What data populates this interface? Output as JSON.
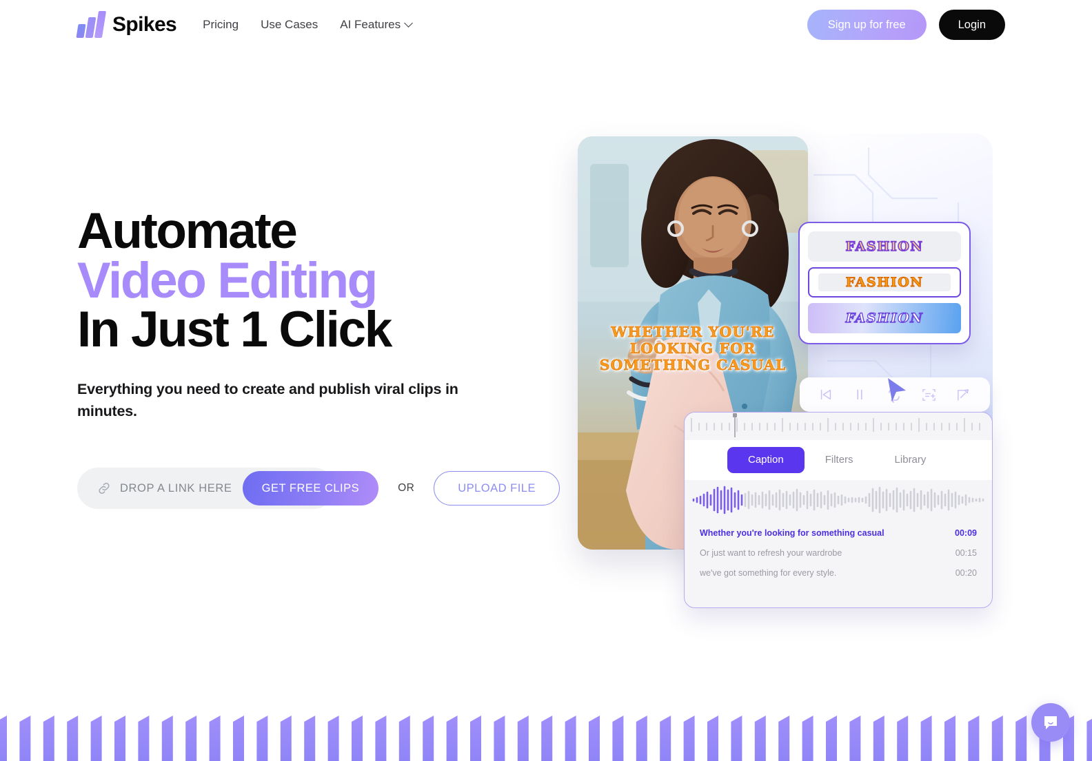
{
  "header": {
    "brand_name": "Spikes",
    "logo_icon": "spikes-bars-logo",
    "nav": [
      {
        "label": "Pricing",
        "icon": ""
      },
      {
        "label": "Use Cases",
        "icon": ""
      },
      {
        "label": "AI Features",
        "icon": "chevron-down-icon"
      }
    ],
    "signup_label": "Sign up for free",
    "login_label": "Login"
  },
  "hero": {
    "title_line1": "Automate",
    "title_line2": "Video Editing",
    "title_line3": "In Just 1 Click",
    "accent_color": "#a78bfa",
    "subtitle": "Everything you need to create and publish viral clips in minutes.",
    "cta": {
      "link_icon": "link-chain-icon",
      "link_placeholder": "DROP A LINK HERE",
      "link_value": "",
      "primary_label": "GET FREE CLIPS",
      "or_label": "OR",
      "upload_label": "UPLOAD FILE"
    }
  },
  "mockup": {
    "video_caption": "WHETHER YOU'RE LOOKING FOR SOMETHING CASUAL",
    "caption_styles": [
      {
        "label": "FASHION",
        "selected": false
      },
      {
        "label": "FASHION",
        "selected": true
      },
      {
        "label": "FASHION",
        "selected": false
      }
    ],
    "player_controls": [
      "skip-back-icon",
      "pause-icon",
      "loop-icon",
      "add-caption-icon",
      "expand-icon"
    ],
    "tabs": [
      {
        "label": "Caption",
        "active": true
      },
      {
        "label": "Filters",
        "active": false
      },
      {
        "label": "Library",
        "active": false
      }
    ],
    "transcript": [
      {
        "text": "Whether you're looking for something casual",
        "time": "00:09",
        "active": true
      },
      {
        "text": "Or just want to refresh your wardrobe",
        "time": "00:15",
        "active": false
      },
      {
        "text": "we've got something for every style.",
        "time": "00:20",
        "active": false
      }
    ]
  },
  "chat": {
    "icon": "chat-bubble-smile-icon"
  },
  "colors": {
    "purple": "#5b36ef",
    "light_purple": "#a78bfa",
    "caption_orange": "#f59c14",
    "bar_purple": "#9a8cf6"
  }
}
